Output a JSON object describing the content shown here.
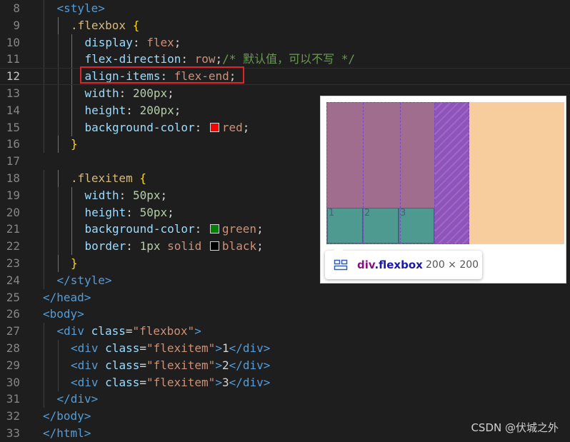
{
  "editor": {
    "lines": [
      {
        "num": "8",
        "segs": [
          [
            "tag",
            "<style>"
          ]
        ]
      },
      {
        "num": "9",
        "segs": [
          [
            "sel",
            ".flexbox "
          ],
          [
            "brace",
            "{"
          ]
        ]
      },
      {
        "num": "10",
        "segs": [
          [
            "prop",
            "display"
          ],
          [
            "txt",
            ": "
          ],
          [
            "val",
            "flex"
          ],
          [
            "txt",
            ";"
          ]
        ]
      },
      {
        "num": "11",
        "segs": [
          [
            "prop",
            "flex-direction"
          ],
          [
            "txt",
            ": "
          ],
          [
            "val",
            "row"
          ],
          [
            "txt",
            ";"
          ],
          [
            "cmt",
            "/* 默认值，可以不写 */"
          ]
        ]
      },
      {
        "num": "12",
        "segs": [
          [
            "prop",
            "align-items"
          ],
          [
            "txt",
            ": "
          ],
          [
            "val",
            "flex-end"
          ],
          [
            "txt",
            ";"
          ]
        ]
      },
      {
        "num": "13",
        "segs": [
          [
            "prop",
            "width"
          ],
          [
            "txt",
            ": "
          ],
          [
            "num",
            "200px"
          ],
          [
            "txt",
            ";"
          ]
        ]
      },
      {
        "num": "14",
        "segs": [
          [
            "prop",
            "height"
          ],
          [
            "txt",
            ": "
          ],
          [
            "num",
            "200px"
          ],
          [
            "txt",
            ";"
          ]
        ]
      },
      {
        "num": "15",
        "segs": [
          [
            "prop",
            "background-color"
          ],
          [
            "txt",
            ": "
          ],
          [
            "swatch",
            "#ff0000"
          ],
          [
            "val",
            "red"
          ],
          [
            "txt",
            ";"
          ]
        ]
      },
      {
        "num": "16",
        "segs": [
          [
            "brace",
            "}"
          ]
        ]
      },
      {
        "num": "17",
        "segs": []
      },
      {
        "num": "18",
        "segs": [
          [
            "sel",
            ".flexitem "
          ],
          [
            "brace",
            "{"
          ]
        ]
      },
      {
        "num": "19",
        "segs": [
          [
            "prop",
            "width"
          ],
          [
            "txt",
            ": "
          ],
          [
            "num",
            "50px"
          ],
          [
            "txt",
            ";"
          ]
        ]
      },
      {
        "num": "20",
        "segs": [
          [
            "prop",
            "height"
          ],
          [
            "txt",
            ": "
          ],
          [
            "num",
            "50px"
          ],
          [
            "txt",
            ";"
          ]
        ]
      },
      {
        "num": "21",
        "segs": [
          [
            "prop",
            "background-color"
          ],
          [
            "txt",
            ": "
          ],
          [
            "swatch",
            "#008000"
          ],
          [
            "val",
            "green"
          ],
          [
            "txt",
            ";"
          ]
        ]
      },
      {
        "num": "22",
        "segs": [
          [
            "prop",
            "border"
          ],
          [
            "txt",
            ": "
          ],
          [
            "num",
            "1px"
          ],
          [
            "txt",
            " "
          ],
          [
            "val",
            "solid"
          ],
          [
            "txt",
            " "
          ],
          [
            "swatch",
            "#000000"
          ],
          [
            "val",
            "black"
          ],
          [
            "txt",
            ";"
          ]
        ]
      },
      {
        "num": "23",
        "segs": [
          [
            "brace",
            "}"
          ]
        ]
      },
      {
        "num": "24",
        "segs": [
          [
            "tag",
            "</style>"
          ]
        ]
      },
      {
        "num": "25",
        "segs": [
          [
            "tag",
            "</head>"
          ]
        ]
      },
      {
        "num": "26",
        "segs": [
          [
            "tag",
            "<body>"
          ]
        ]
      },
      {
        "num": "27",
        "segs": [
          [
            "tag",
            "<div "
          ],
          [
            "attr",
            "class"
          ],
          [
            "txt",
            "="
          ],
          [
            "str",
            "\"flexbox\""
          ],
          [
            "tag",
            ">"
          ]
        ]
      },
      {
        "num": "28",
        "segs": [
          [
            "tag",
            "<div "
          ],
          [
            "attr",
            "class"
          ],
          [
            "txt",
            "="
          ],
          [
            "str",
            "\"flexitem\""
          ],
          [
            "tag",
            ">"
          ],
          [
            "txt",
            "1"
          ],
          [
            "tag",
            "</div>"
          ]
        ]
      },
      {
        "num": "29",
        "segs": [
          [
            "tag",
            "<div "
          ],
          [
            "attr",
            "class"
          ],
          [
            "txt",
            "="
          ],
          [
            "str",
            "\"flexitem\""
          ],
          [
            "tag",
            ">"
          ],
          [
            "txt",
            "2"
          ],
          [
            "tag",
            "</div>"
          ]
        ]
      },
      {
        "num": "30",
        "segs": [
          [
            "tag",
            "<div "
          ],
          [
            "attr",
            "class"
          ],
          [
            "txt",
            "="
          ],
          [
            "str",
            "\"flexitem\""
          ],
          [
            "tag",
            ">"
          ],
          [
            "txt",
            "3"
          ],
          [
            "tag",
            "</div>"
          ]
        ]
      },
      {
        "num": "31",
        "segs": [
          [
            "tag",
            "</div>"
          ]
        ]
      },
      {
        "num": "32",
        "segs": [
          [
            "tag",
            "</body>"
          ]
        ]
      },
      {
        "num": "33",
        "segs": [
          [
            "tag",
            "</html>"
          ]
        ]
      }
    ],
    "current_line": "12"
  },
  "preview": {
    "items": [
      "1",
      "2",
      "3"
    ],
    "tooltip": {
      "tag": "div",
      "class": ".flexbox",
      "size": "200 × 200"
    }
  },
  "watermark": "CSDN @伏城之外",
  "colors": {
    "highlight_box": "#e0242c",
    "flexbox_bg": "#a06d8e",
    "flexitem_bg": "#4f9a90",
    "margin_bg": "#f8cd9e"
  }
}
